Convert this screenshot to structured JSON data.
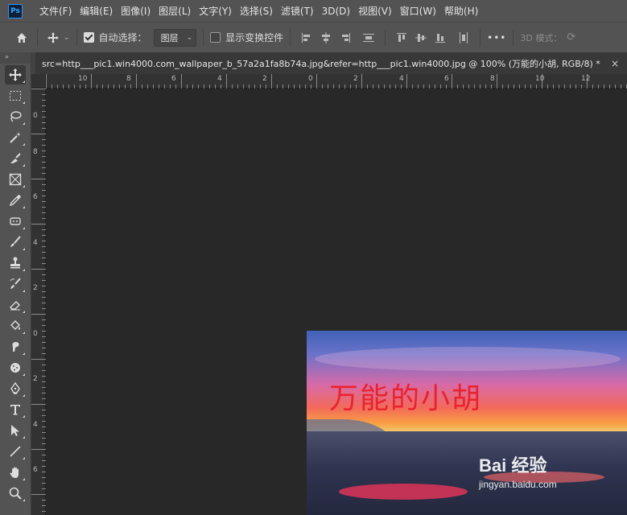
{
  "app": {
    "logo_text": "Ps"
  },
  "menu": [
    {
      "label": "文件(F)"
    },
    {
      "label": "编辑(E)"
    },
    {
      "label": "图像(I)"
    },
    {
      "label": "图层(L)"
    },
    {
      "label": "文字(Y)"
    },
    {
      "label": "选择(S)"
    },
    {
      "label": "滤镜(T)"
    },
    {
      "label": "3D(D)"
    },
    {
      "label": "视图(V)"
    },
    {
      "label": "窗口(W)"
    },
    {
      "label": "帮助(H)"
    }
  ],
  "options": {
    "auto_select_label": "自动选择：",
    "auto_select_checked": true,
    "auto_select_target": "图层",
    "show_transform_label": "显示变换控件",
    "show_transform_checked": false,
    "more_label": "•••",
    "mode_3d_label": "3D 模式："
  },
  "document": {
    "tab_title": "src=http___pic1.win4000.com_wallpaper_b_57a2a1fa8b74a.jpg&refer=http___pic1.win4000.jpg @ 100% (万能的小胡, RGB/8) *",
    "close_symbol": "×"
  },
  "ruler": {
    "top_labels": [
      "10",
      "8",
      "6",
      "4",
      "2",
      "0",
      "2",
      "4",
      "6",
      "8",
      "10",
      "12"
    ],
    "left_labels": [
      "0",
      "8",
      "6",
      "4",
      "2",
      "0",
      "2",
      "4",
      "6"
    ]
  },
  "canvas": {
    "overlay_text": "万能的小胡",
    "overlay_color": "#e8232f",
    "watermark_brand": "Bai 经验",
    "watermark_url": "jingyan.baidu.com"
  },
  "tools": [
    {
      "name": "move-tool-icon"
    },
    {
      "name": "marquee-tool-icon"
    },
    {
      "name": "lasso-tool-icon"
    },
    {
      "name": "magic-wand-tool-icon"
    },
    {
      "name": "eyedropper-brush-tool-icon"
    },
    {
      "name": "frame-tool-icon"
    },
    {
      "name": "eyedropper-tool-icon"
    },
    {
      "name": "healing-tool-icon"
    },
    {
      "name": "brush-tool-icon"
    },
    {
      "name": "stamp-tool-icon"
    },
    {
      "name": "history-brush-tool-icon"
    },
    {
      "name": "eraser-tool-icon"
    },
    {
      "name": "paint-bucket-tool-icon"
    },
    {
      "name": "smudge-tool-icon"
    },
    {
      "name": "sponge-tool-icon"
    },
    {
      "name": "pen-tool-icon"
    },
    {
      "name": "type-tool-icon"
    },
    {
      "name": "path-select-tool-icon"
    },
    {
      "name": "line-tool-icon"
    },
    {
      "name": "hand-tool-icon"
    },
    {
      "name": "zoom-tool-icon"
    }
  ]
}
